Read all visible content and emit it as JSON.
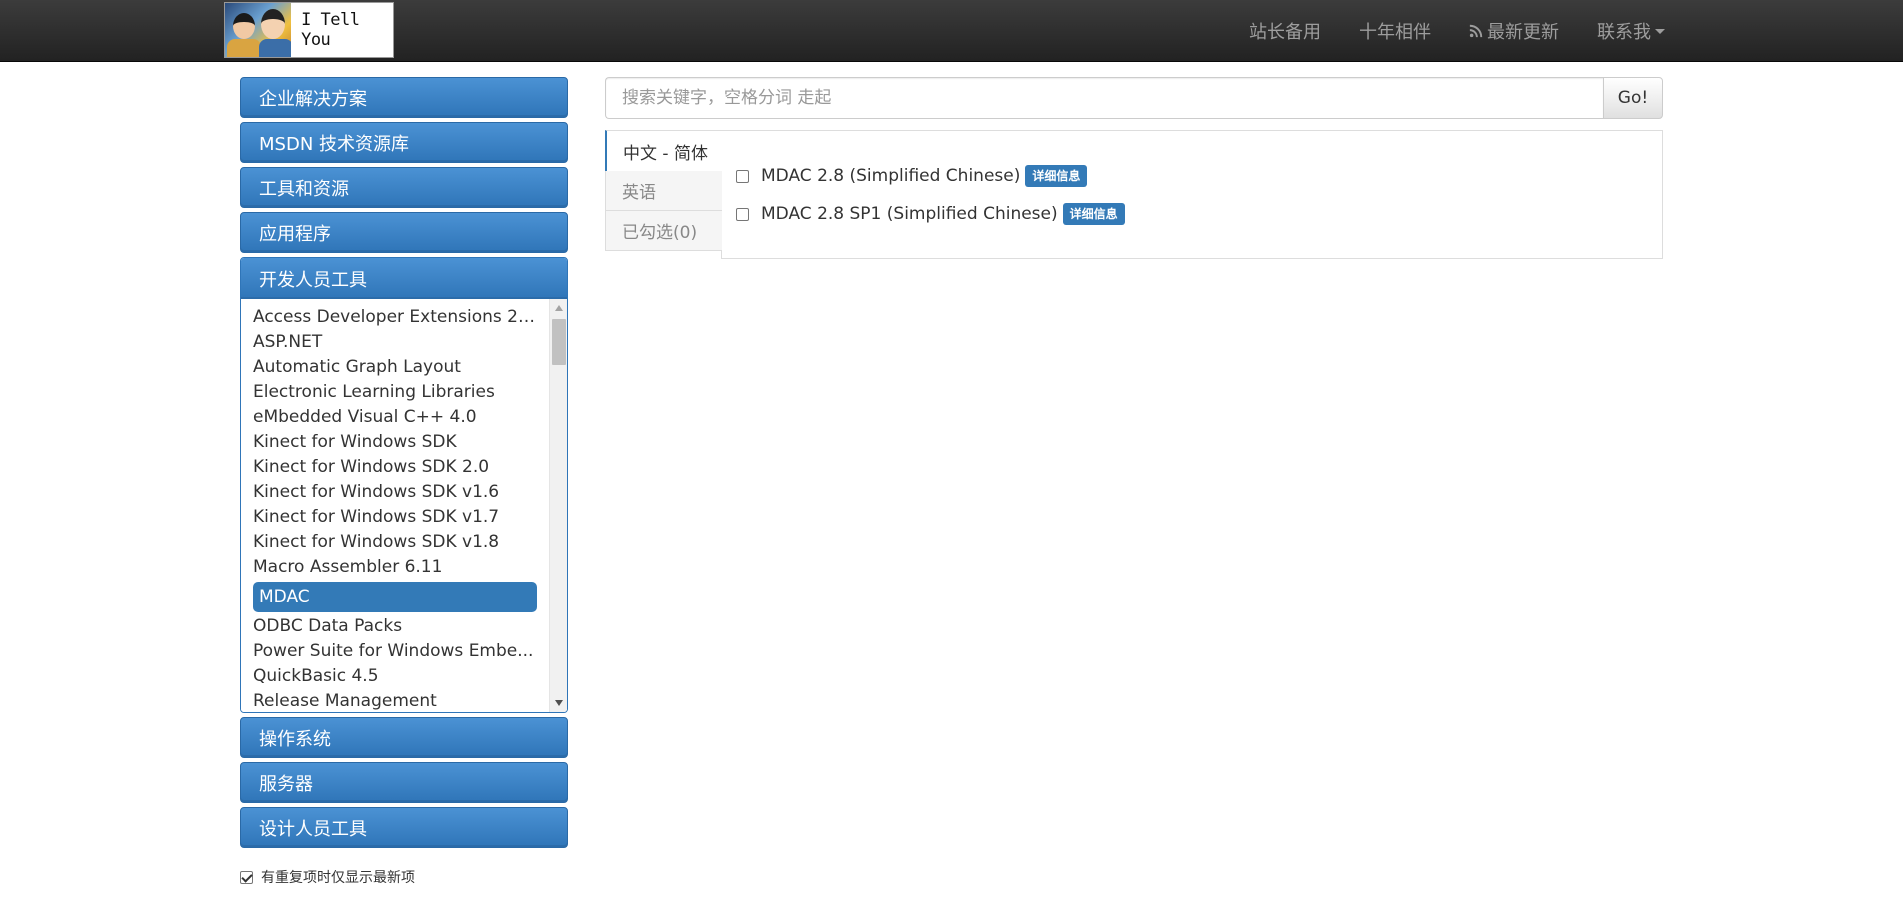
{
  "brand": {
    "logo_text": "I Tell You"
  },
  "nav": {
    "items": [
      {
        "label": "站长备用"
      },
      {
        "label": "十年相伴"
      },
      {
        "label": "最新更新"
      },
      {
        "label": "联系我"
      }
    ]
  },
  "sidebar": {
    "sections_top": [
      {
        "label": "企业解决方案"
      },
      {
        "label": "MSDN 技术资源库"
      },
      {
        "label": "工具和资源"
      },
      {
        "label": "应用程序"
      }
    ],
    "open_section": {
      "label": "开发人员工具",
      "items": [
        "Access Developer Extensions 20...",
        "ASP.NET",
        "Automatic Graph Layout",
        "Electronic Learning Libraries",
        "eMbedded Visual C++ 4.0",
        "Kinect for Windows SDK",
        "Kinect for Windows SDK 2.0",
        "Kinect for Windows SDK v1.6",
        "Kinect for Windows SDK v1.7",
        "Kinect for Windows SDK v1.8",
        "Macro Assembler 6.11",
        "MDAC",
        "ODBC Data Packs",
        "Power Suite for Windows Embe...",
        "QuickBasic 4.5",
        "Release Management"
      ],
      "active_item": "MDAC"
    },
    "sections_bottom": [
      {
        "label": "操作系统"
      },
      {
        "label": "服务器"
      },
      {
        "label": "设计人员工具"
      }
    ],
    "dedupe_label": "有重复项时仅显示最新项"
  },
  "search": {
    "placeholder": "搜索关键字，空格分词 走起",
    "button_label": "Go!"
  },
  "language_tabs": [
    {
      "label": "中文 - 简体"
    },
    {
      "label": "英语"
    },
    {
      "label": "已勾选(0)"
    }
  ],
  "files": [
    {
      "name": "MDAC 2.8 (Simplified Chinese)",
      "badge": "详细信息"
    },
    {
      "name": "MDAC 2.8 SP1 (Simplified Chinese)",
      "badge": "详细信息"
    }
  ],
  "colors": {
    "accent": "#337ab7",
    "navbar": "#222222"
  }
}
